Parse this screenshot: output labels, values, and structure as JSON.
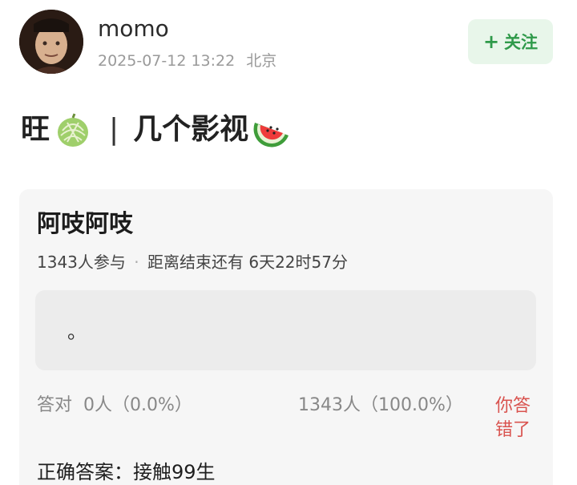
{
  "header": {
    "username": "momo",
    "timestamp": "2025-07-12 13:22",
    "location": "北京",
    "follow_button": {
      "plus": "+",
      "label": "关注"
    }
  },
  "post": {
    "title_part1": "旺",
    "title_emoji1": "melon-emoji",
    "title_separator": "|",
    "title_part2": "几个影视",
    "title_emoji2": "watermelon-emoji"
  },
  "quiz": {
    "title": "阿吱阿吱",
    "participants": "1343人参与",
    "separator": "·",
    "deadline": "距离结束还有 6天22时57分",
    "option_text": "。",
    "result_correct_label": "答对",
    "result_correct_count": "0人（0.0%）",
    "result_wrong_count": "1343人（100.0%）",
    "result_status": "你答错了",
    "correct_answer": "正确答案：接触99生"
  },
  "colors": {
    "accent_green": "#2f9a4a",
    "follow_bg": "#e8f6ea",
    "wrong_red": "#d9534f",
    "card_bg": "#f6f6f6"
  }
}
